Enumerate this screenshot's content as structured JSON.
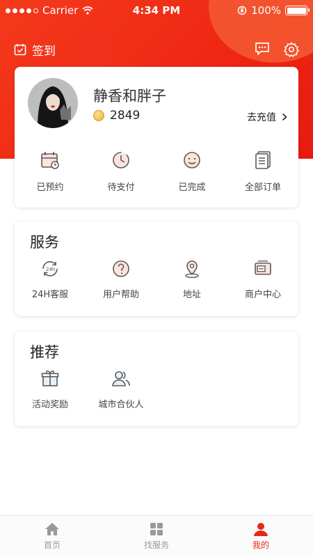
{
  "status_bar": {
    "carrier": "Carrier",
    "time": "4:34 PM",
    "battery": "100%",
    "battery_level": 1.0
  },
  "header": {
    "signin_label": "签到"
  },
  "profile": {
    "username": "静香和胖子",
    "coins": "2849",
    "recharge_label": "去充值",
    "orders": [
      {
        "label": "已预约",
        "icon": "calendar-clock-icon"
      },
      {
        "label": "待支付",
        "icon": "clock-pending-icon"
      },
      {
        "label": "已完成",
        "icon": "smile-icon"
      },
      {
        "label": "全部订单",
        "icon": "document-list-icon"
      }
    ]
  },
  "service": {
    "title": "服务",
    "items": [
      {
        "label": "24H客服",
        "icon": "24h-icon"
      },
      {
        "label": "用户帮助",
        "icon": "help-icon"
      },
      {
        "label": "地址",
        "icon": "location-pin-icon"
      },
      {
        "label": "商户中心",
        "icon": "merchant-card-icon"
      }
    ]
  },
  "recommend": {
    "title": "推荐",
    "items": [
      {
        "label": "活动奖励",
        "icon": "gift-icon"
      },
      {
        "label": "城市合伙人",
        "icon": "partners-icon"
      }
    ]
  },
  "tabbar": {
    "tabs": [
      {
        "label": "首页",
        "icon": "home-icon"
      },
      {
        "label": "找服务",
        "icon": "grid-icon"
      },
      {
        "label": "我的",
        "icon": "user-icon",
        "active": true
      }
    ]
  },
  "colors": {
    "brand_red": "#ef2814",
    "active_tab": "#e8281a",
    "icon_gray": "#5a5a5a"
  }
}
